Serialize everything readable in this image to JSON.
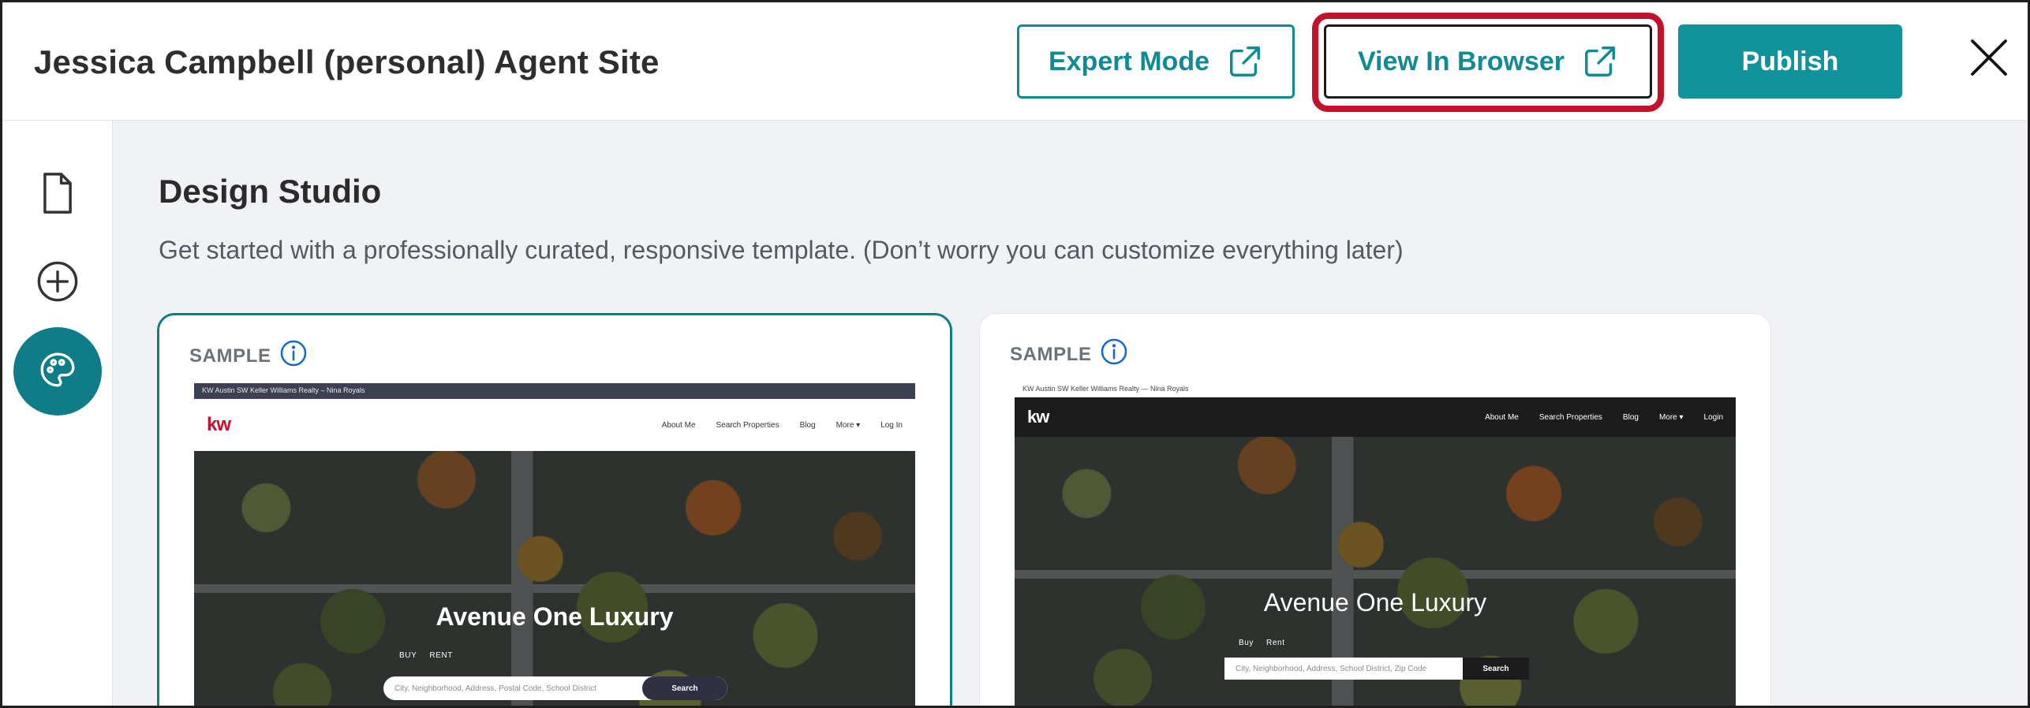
{
  "header": {
    "site_title": "Jessica Campbell (personal) Agent Site",
    "expert_mode_label": "Expert Mode",
    "view_in_browser_label": "View In Browser",
    "publish_label": "Publish"
  },
  "sidebar": {
    "items": [
      {
        "name": "pages",
        "icon": "document-icon"
      },
      {
        "name": "add",
        "icon": "plus-circle-icon"
      },
      {
        "name": "design",
        "icon": "palette-icon",
        "active": true
      }
    ]
  },
  "main": {
    "title": "Design Studio",
    "subtitle": "Get started with a professionally curated, responsive template. (Don’t worry you can customize everything later)"
  },
  "templates": [
    {
      "label": "SAMPLE",
      "selected": true,
      "topbar_text": "KW Austin SW Keller Williams Realty – Nina Royals",
      "logo": "kw",
      "nav": [
        "About Me",
        "Search Properties",
        "Blog",
        "More ▾",
        "Log In"
      ],
      "hero_title": "Avenue One Luxury",
      "tabs": [
        "BUY",
        "RENT"
      ],
      "search_placeholder": "City, Neighborhood, Address, Postal Code, School District",
      "search_button": "Search"
    },
    {
      "label": "SAMPLE",
      "selected": false,
      "topbar_text": "KW Austin SW Keller Williams Realty — Nina Royals",
      "logo": "kw",
      "nav": [
        "About Me",
        "Search Properties",
        "Blog",
        "More ▾",
        "Login"
      ],
      "hero_title": "Avenue One Luxury",
      "tabs": [
        "Buy",
        "Rent"
      ],
      "search_placeholder": "City, Neighborhood, Address, School District, Zip Code",
      "search_button": "Search"
    }
  ],
  "colors": {
    "accent": "#0f8b96",
    "highlight_ring": "#c0132b"
  }
}
